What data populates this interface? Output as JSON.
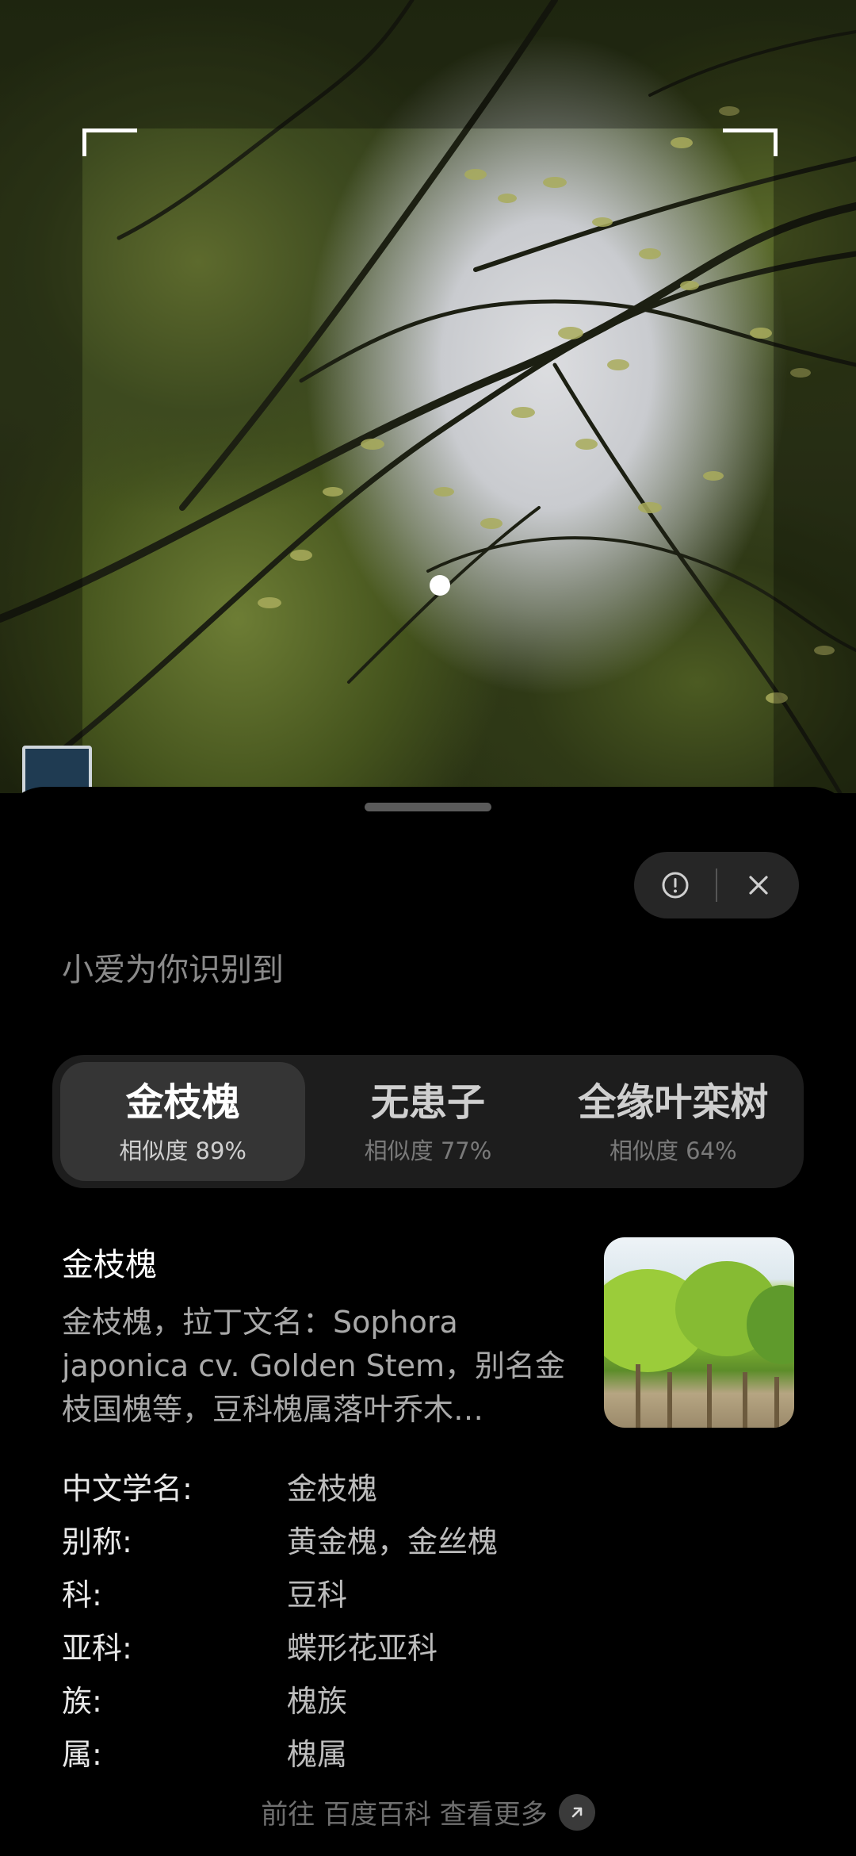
{
  "header": {
    "subtitle": "小爱为你识别到"
  },
  "actions": {
    "info_icon": "alert-circle-icon",
    "close_icon": "close-icon"
  },
  "results": [
    {
      "name": "金枝槐",
      "similarity": "相似度 89%"
    },
    {
      "name": "无患子",
      "similarity": "相似度 77%"
    },
    {
      "name": "全缘叶栾树",
      "similarity": "相似度 64%"
    }
  ],
  "detail": {
    "title": "金枝槐",
    "description": "金枝槐，拉丁文名：Sophora japonica cv. Golden Stem，别名金枝国槐等，豆科槐属落叶乔木…"
  },
  "info_rows": [
    {
      "key": "中文学名:",
      "value": "金枝槐"
    },
    {
      "key": "别称:",
      "value": "黄金槐，金丝槐"
    },
    {
      "key": "科:",
      "value": "豆科"
    },
    {
      "key": "亚科:",
      "value": "蝶形花亚科"
    },
    {
      "key": "族:",
      "value": "槐族"
    },
    {
      "key": "属:",
      "value": "槐属"
    }
  ],
  "footer": {
    "link_text": "前往 百度百科 查看更多"
  },
  "colors": {
    "sheet_bg": "#000000",
    "tab_active_bg": "#353535",
    "tab_bar_bg": "#1d1d1d"
  }
}
